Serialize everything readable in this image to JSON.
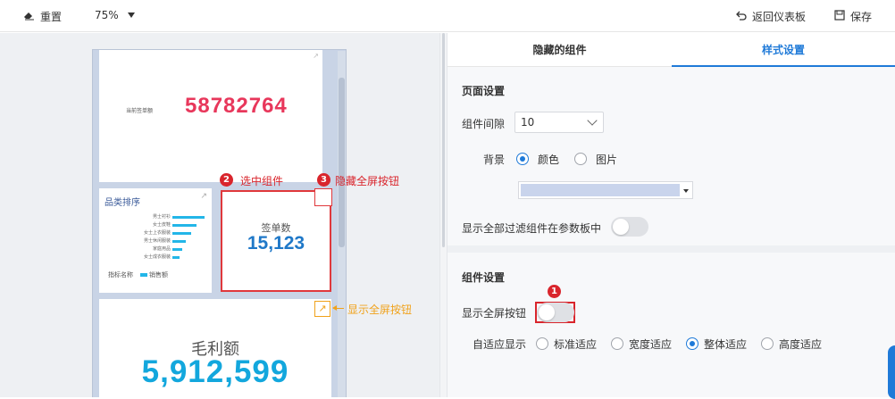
{
  "toolbar": {
    "reset_label": "重置",
    "zoom_value": "75%",
    "back_label": "返回仪表板",
    "save_label": "保存"
  },
  "canvas": {
    "sign_card": {
      "label": "当前签单额",
      "value": "58782764"
    },
    "category_card": {
      "title": "品类排序",
      "rows": [
        {
          "label": "男士衬衫",
          "value": 0.95
        },
        {
          "label": "女士皮鞋",
          "value": 0.72
        },
        {
          "label": "女士上衣服装",
          "value": 0.55
        },
        {
          "label": "男士休闲服装",
          "value": 0.4
        },
        {
          "label": "家庭用品",
          "value": 0.3
        },
        {
          "label": "女士成衣服装",
          "value": 0.22
        }
      ],
      "legend_title": "指标名称",
      "legend_items": [
        "销售额",
        "毛利"
      ]
    },
    "count_card": {
      "label": "签单数",
      "value": "15,123"
    },
    "profit_card": {
      "label": "毛利额",
      "value": "5,912,599"
    }
  },
  "annotations": {
    "select_num": "2",
    "select_text": "选中组件",
    "hide_num": "3",
    "hide_text": "隐藏全屏按钮",
    "show_text": "显示全屏按钮",
    "toggle_num": "1"
  },
  "panel": {
    "tabs": [
      "隐藏的组件",
      "样式设置"
    ],
    "page_section": "页面设置",
    "gap_label": "组件间隙",
    "gap_value": "10",
    "bg_label": "背景",
    "bg_options": [
      "颜色",
      "图片"
    ],
    "bg_color": "#c9d4ec",
    "show_filters_label": "显示全部过滤组件在参数板中",
    "show_filters_on": false,
    "component_section": "组件设置",
    "fullscreen_label": "显示全屏按钮",
    "fullscreen_on": false,
    "adapt_label": "自适应显示",
    "adapt_options": [
      "标准适应",
      "宽度适应",
      "整体适应",
      "高度适应"
    ],
    "adapt_selected": "整体适应"
  },
  "colors": {
    "accent": "#1f7ad8",
    "annotation_red": "#d9252c",
    "annotation_orange": "#f0a21b",
    "sign_value": "#e8375b",
    "profit_value": "#13a7dd"
  }
}
